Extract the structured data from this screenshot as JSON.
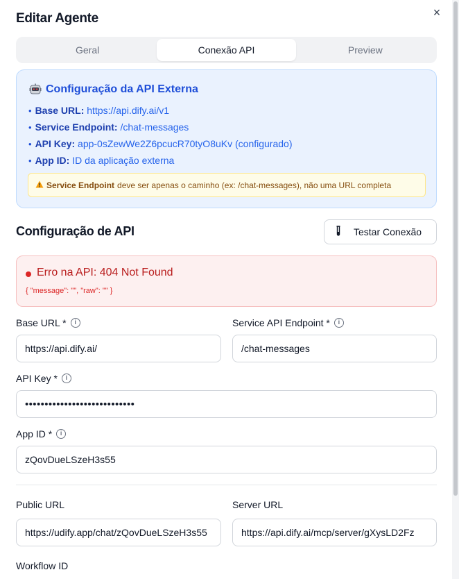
{
  "dialog": {
    "title": "Editar Agente",
    "close_glyph": "×"
  },
  "tabs": [
    {
      "label": "Geral",
      "active": false
    },
    {
      "label": "Conexão API",
      "active": true
    },
    {
      "label": "Preview",
      "active": false
    }
  ],
  "info": {
    "title": "Configuração da API Externa",
    "icon": "robot-icon",
    "lines": [
      {
        "key": "Base URL:",
        "value": "https://api.dify.ai/v1"
      },
      {
        "key": "Service Endpoint:",
        "value": "/chat-messages"
      },
      {
        "key": "API Key:",
        "value": "app-0sZewWe2Z6pcucR70tyO8uKv (configurado)"
      },
      {
        "key": "App ID:",
        "value": "ID da aplicação externa"
      }
    ],
    "warning": {
      "strong": "Service Endpoint",
      "text": "deve ser apenas o caminho (ex: /chat-messages), não uma URL completa"
    }
  },
  "api_section": {
    "title": "Configuração de API",
    "test_button": "Testar Conexão"
  },
  "error": {
    "title": "Erro na API: 404 Not Found",
    "raw": "{ \"message\": \"\", \"raw\": \"\" }"
  },
  "fields": {
    "base_url": {
      "label": "Base URL *",
      "value": "https://api.dify.ai/"
    },
    "service_endpoint": {
      "label": "Service API Endpoint *",
      "value": "/chat-messages"
    },
    "api_key": {
      "label": "API Key *",
      "value": "••••••••••••••••••••••••••••"
    },
    "app_id": {
      "label": "App ID *",
      "value": "zQovDueLSzeH3s55"
    },
    "public_url": {
      "label": "Public URL",
      "value": "https://udify.app/chat/zQovDueLSzeH3s55"
    },
    "server_url": {
      "label": "Server URL",
      "value": "https://api.dify.ai/mcp/server/gXysLD2Fz"
    },
    "workflow_id": {
      "label": "Workflow ID"
    }
  },
  "colors": {
    "accent": "#2563eb",
    "error": "#dc2626",
    "warning_bg": "#fefce8"
  }
}
